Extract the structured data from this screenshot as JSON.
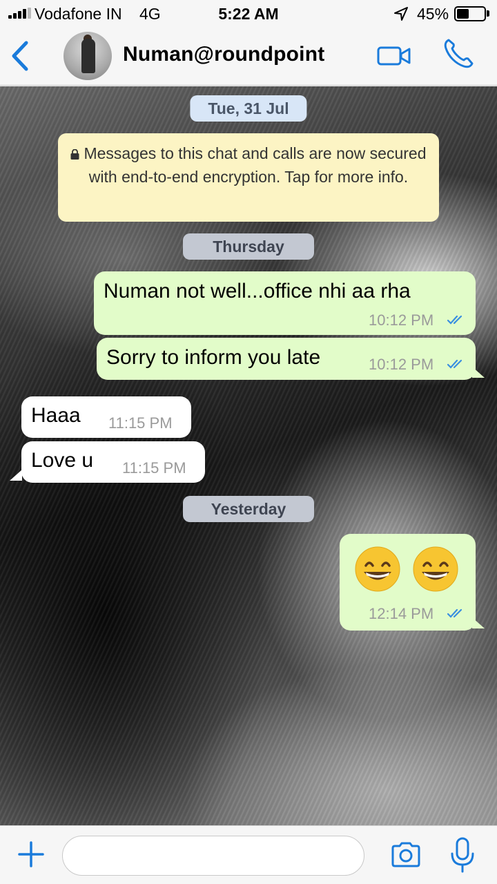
{
  "status_bar": {
    "carrier": "Vodafone IN",
    "network": "4G",
    "time": "5:22 AM",
    "battery": "45%",
    "battery_level": 0.45
  },
  "header": {
    "contact_name": "Numan@roundpoint",
    "icons": [
      "back-chevron-icon",
      "avatar",
      "video-call-icon",
      "voice-call-icon"
    ],
    "accent_color": "#1a7bdb"
  },
  "chat": {
    "date_pills": [
      "Tue, 31 Jul",
      "Thursday",
      "Yesterday"
    ],
    "encryption_notice": "Messages to this chat and calls are now secured with end-to-end encryption. Tap for more info.",
    "messages": [
      {
        "direction": "out",
        "text": "Numan not well...office nhi aa rha",
        "time": "10:12 PM",
        "status": "read"
      },
      {
        "direction": "out",
        "text": "Sorry to inform you late",
        "time": "10:12 PM",
        "status": "read"
      },
      {
        "direction": "in",
        "text": "Haaa",
        "time": "11:15 PM"
      },
      {
        "direction": "in",
        "text": "Love u",
        "time": "11:15 PM"
      },
      {
        "direction": "out",
        "text": "😄 😄",
        "time": "12:14 PM",
        "status": "read"
      }
    ],
    "colors": {
      "outgoing_bubble": "#e2fcc9",
      "incoming_bubble": "#ffffff",
      "read_ticks": "#3a8fe0",
      "notice": "#fcf4c4"
    }
  },
  "input_bar": {
    "message_value": "",
    "icons": [
      "plus-icon",
      "camera-icon",
      "microphone-icon"
    ]
  }
}
